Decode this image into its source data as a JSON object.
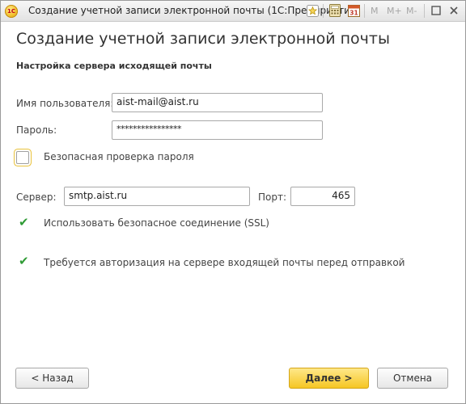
{
  "window": {
    "title": "Создание учетной записи электронной почты  (1С:Предприятие)",
    "logo_text": "1С",
    "toolbar": {
      "m": "M",
      "m_plus": "M+",
      "m_minus": "M-"
    },
    "calendar_day": "31"
  },
  "form": {
    "heading": "Создание учетной записи электронной почты",
    "section_title": "Настройка сервера исходящей почты",
    "username_label": "Имя пользователя:",
    "username_value": "aist-mail@aist.ru",
    "password_label": "Пароль:",
    "password_value": "****************",
    "secure_auth_label": "Безопасная проверка пароля",
    "secure_auth_checked": false,
    "server_label": "Сервер:",
    "server_value": "smtp.aist.ru",
    "port_label": "Порт:",
    "port_value": "465",
    "ssl_label": "Использовать безопасное соединение (SSL)",
    "ssl_checked": true,
    "auth_before_send_label": "Требуется авторизация на сервере входящей почты перед отправкой",
    "auth_before_send_checked": true
  },
  "buttons": {
    "back": "< Назад",
    "next": "Далее >",
    "cancel": "Отмена"
  },
  "colors": {
    "accent": "#f5c624",
    "check": "#2f9b35",
    "focus": "#e9c23c"
  }
}
